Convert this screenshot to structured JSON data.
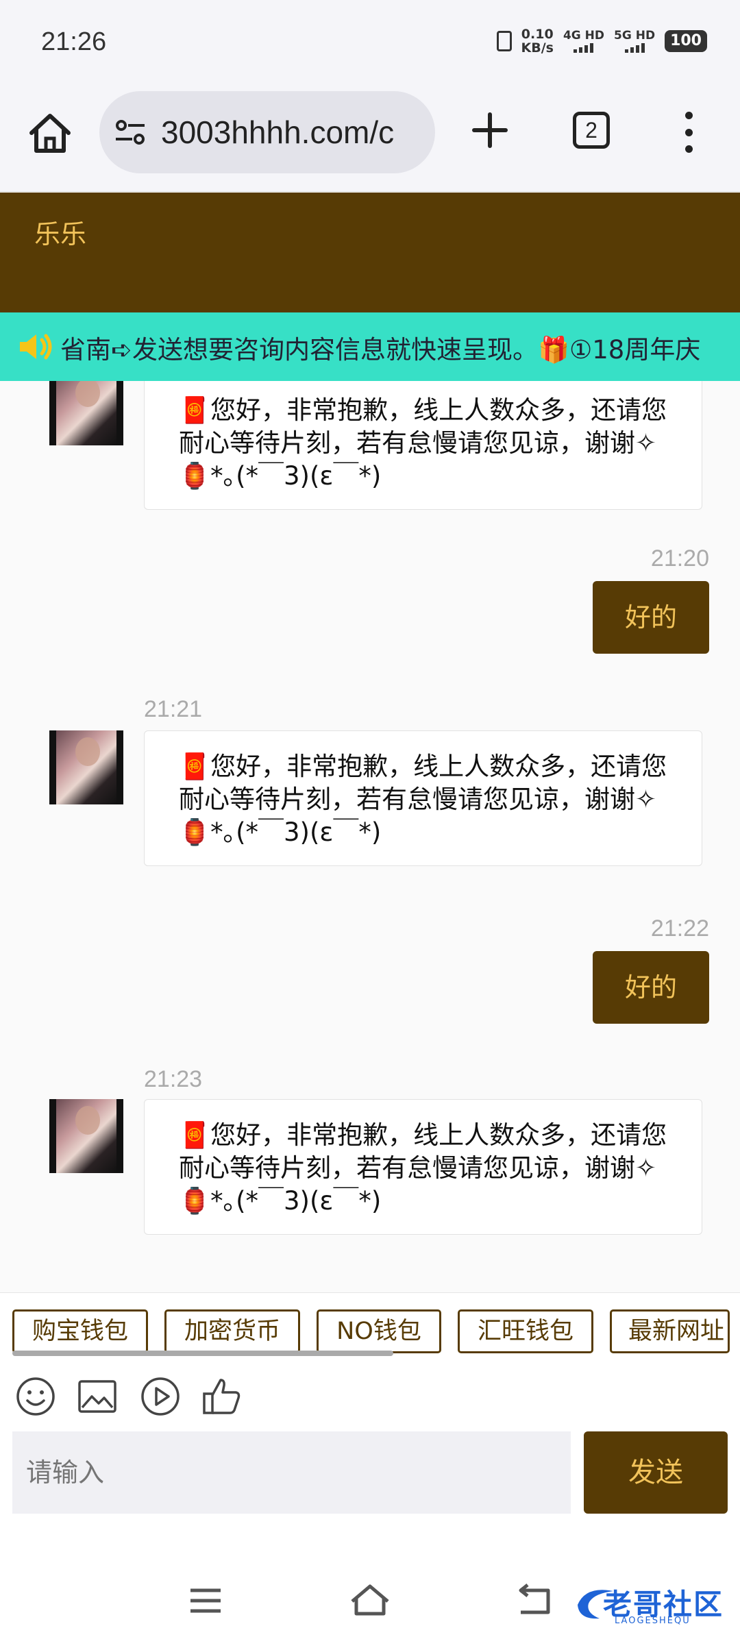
{
  "status_bar": {
    "time": "21:26",
    "net_speed_value": "0.10",
    "net_speed_unit": "KB/s",
    "sim1": "4G HD",
    "sim2": "5G HD",
    "battery": "100"
  },
  "browser": {
    "url": "3003hhhh.com/c",
    "tab_count": "2"
  },
  "chat": {
    "title": "乐乐",
    "notice": "省南➪发送想要咨询内容信息就快速呈现。🎁①18周年庆",
    "messages": [
      {
        "side": "left",
        "time": "",
        "text": "🧧您好，非常抱歉，线上人数众多，还请您耐心等待片刻，若有怠慢请您见谅，谢谢✧🏮*｡(*￣3)(ε￣*)"
      },
      {
        "side": "right",
        "time": "21:20",
        "text": "好的"
      },
      {
        "side": "left",
        "time": "21:21",
        "text": "🧧您好，非常抱歉，线上人数众多，还请您耐心等待片刻，若有怠慢请您见谅，谢谢✧🏮*｡(*￣3)(ε￣*)"
      },
      {
        "side": "right",
        "time": "21:22",
        "text": "好的"
      },
      {
        "side": "left",
        "time": "21:23",
        "text": "🧧您好，非常抱歉，线上人数众多，还请您耐心等待片刻，若有怠慢请您见谅，谢谢✧🏮*｡(*￣3)(ε￣*)"
      }
    ]
  },
  "quick_replies": [
    "购宝钱包",
    "加密货币",
    "NO钱包",
    "汇旺钱包",
    "最新网址"
  ],
  "composer": {
    "placeholder": "请输入",
    "send_label": "发送"
  },
  "watermark": {
    "title": "老哥社区",
    "subtitle": "LAOGESHEQU"
  },
  "colors": {
    "brand_dark": "#573b05",
    "brand_gold": "#f2c35a",
    "notice_bg": "#37e0c6"
  }
}
